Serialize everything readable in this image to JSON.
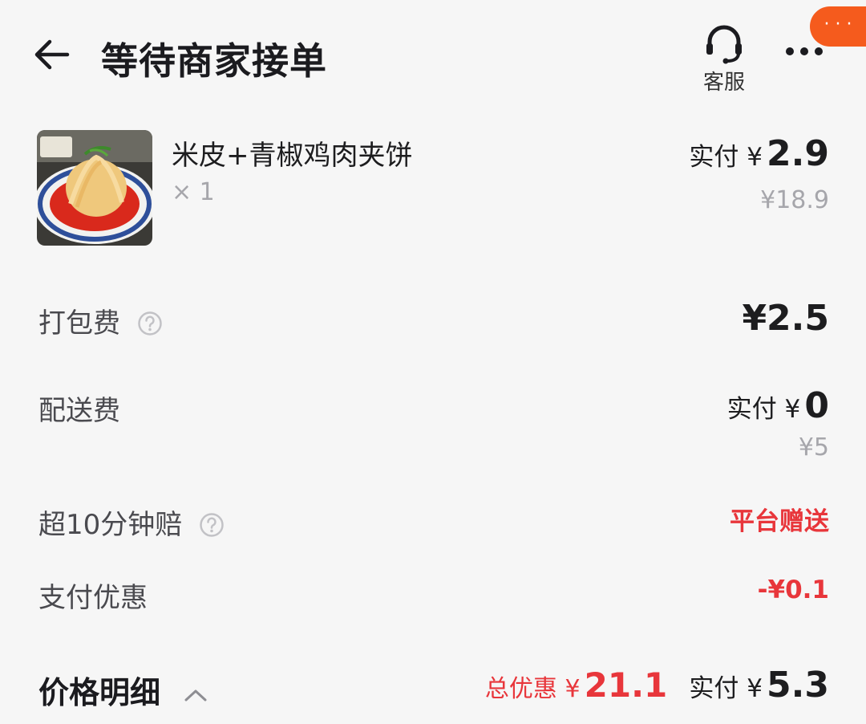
{
  "header": {
    "title": "等待商家接单",
    "service_label": "客服",
    "mini_badge": "· · ·"
  },
  "product": {
    "name": "米皮+青椒鸡肉夹饼",
    "quantity": "× 1",
    "actual_label": "实付 ¥",
    "actual_price": "2.9",
    "original_price": "¥18.9"
  },
  "fees": {
    "packing": {
      "label": "打包费",
      "value": "¥2.5"
    },
    "delivery": {
      "label": "配送费",
      "actual_label": "实付 ¥",
      "actual_value": "0",
      "original_value": "¥5"
    },
    "late_comp": {
      "label": "超10分钟赔",
      "value": "平台赠送"
    },
    "pay_discount": {
      "label": "支付优惠",
      "value": "-¥0.1"
    }
  },
  "footer": {
    "title": "价格明细",
    "discount_label": "总优惠 ¥",
    "discount_value": "21.1",
    "actual_label": "实付 ¥",
    "actual_value": "5.3"
  },
  "colors": {
    "accent_red": "#e8363b",
    "badge_orange": "#f55b1d",
    "background": "#f6f6f6"
  }
}
